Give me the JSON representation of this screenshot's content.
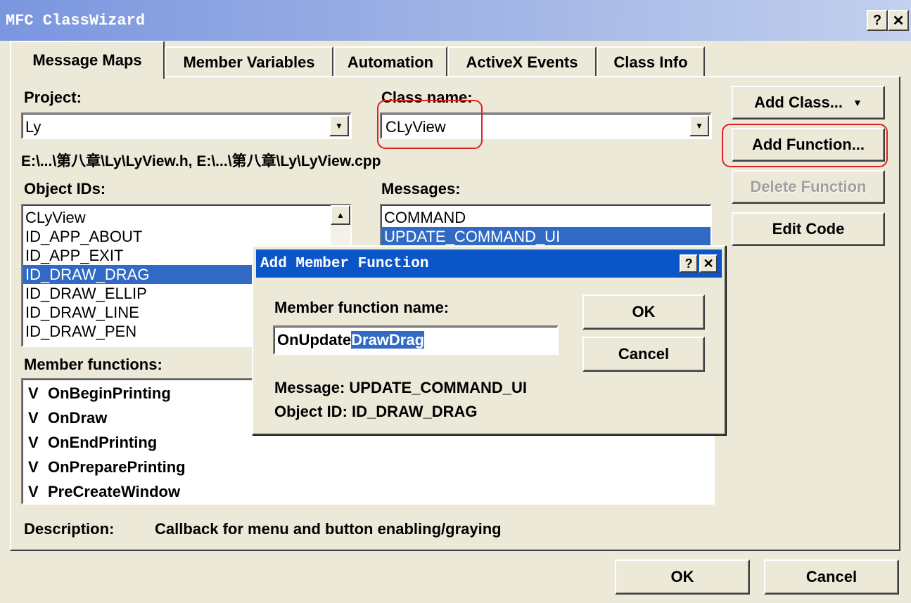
{
  "window": {
    "title": "MFC ClassWizard",
    "help_glyph": "?",
    "close_glyph": "✕"
  },
  "tabs": [
    {
      "label": "Message Maps"
    },
    {
      "label": "Member Variables"
    },
    {
      "label": "Automation"
    },
    {
      "label": "ActiveX Events"
    },
    {
      "label": "Class Info"
    }
  ],
  "project": {
    "label": "Project:",
    "value": "Ly"
  },
  "class_name": {
    "label": "Class name:",
    "value": "CLyView"
  },
  "file_path": "E:\\...\\第八章\\Ly\\LyView.h, E:\\...\\第八章\\Ly\\LyView.cpp",
  "object_ids": {
    "label": "Object IDs:",
    "items": [
      "CLyView",
      "ID_APP_ABOUT",
      "ID_APP_EXIT",
      "ID_DRAW_DRAG",
      "ID_DRAW_ELLIP",
      "ID_DRAW_LINE",
      "ID_DRAW_PEN"
    ],
    "selected": "ID_DRAW_DRAG"
  },
  "messages": {
    "label": "Messages:",
    "items": [
      "COMMAND",
      "UPDATE_COMMAND_UI"
    ],
    "selected": "UPDATE_COMMAND_UI"
  },
  "member_functions": {
    "label": "Member functions:",
    "items": [
      {
        "type": "V",
        "name": "OnBeginPrinting"
      },
      {
        "type": "V",
        "name": "OnDraw"
      },
      {
        "type": "V",
        "name": "OnEndPrinting"
      },
      {
        "type": "V",
        "name": "OnPreparePrinting"
      },
      {
        "type": "V",
        "name": "PreCreateWindow"
      }
    ]
  },
  "side_buttons": {
    "add_class": "Add Class...",
    "add_function": "Add Function...",
    "delete_function": "Delete Function",
    "edit_code": "Edit Code"
  },
  "description": {
    "label": "Description:",
    "text": "Callback for menu and button enabling/graying"
  },
  "footer": {
    "ok": "OK",
    "cancel": "Cancel"
  },
  "dialog": {
    "title": "Add Member Function",
    "name_label": "Member function name:",
    "name_value_prefix": "OnUpdate",
    "name_value_selected": "DrawDrag",
    "ok": "OK",
    "cancel": "Cancel",
    "message_line": "Message: UPDATE_COMMAND_UI",
    "object_line": "Object ID: ID_DRAW_DRAG"
  },
  "colors": {
    "selection": "#316ac5",
    "dialog_title": "#0a55c8",
    "annotation": "#e02020"
  }
}
